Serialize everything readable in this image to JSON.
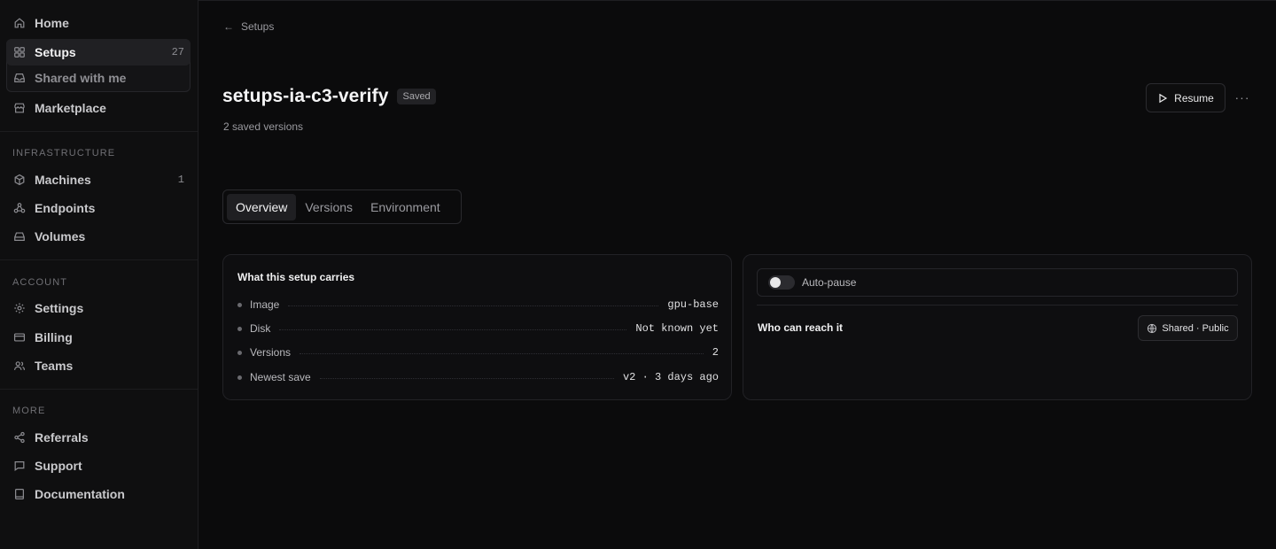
{
  "sidebar": {
    "nav": [
      {
        "label": "Home",
        "icon": "home-icon"
      },
      {
        "label": "Setups",
        "icon": "grid-icon",
        "count": "27"
      },
      {
        "label": "Shared with me",
        "icon": "inbox-icon"
      },
      {
        "label": "Marketplace",
        "icon": "store-icon"
      }
    ],
    "sections": [
      {
        "label": "INFRASTRUCTURE",
        "items": [
          {
            "label": "Machines",
            "icon": "cube-icon",
            "count": "1"
          },
          {
            "label": "Endpoints",
            "icon": "webhook-icon"
          },
          {
            "label": "Volumes",
            "icon": "drive-icon"
          }
        ]
      },
      {
        "label": "ACCOUNT",
        "items": [
          {
            "label": "Settings",
            "icon": "gear-icon"
          },
          {
            "label": "Billing",
            "icon": "card-icon"
          },
          {
            "label": "Teams",
            "icon": "users-icon"
          }
        ]
      },
      {
        "label": "MORE",
        "items": [
          {
            "label": "Referrals",
            "icon": "share-icon"
          },
          {
            "label": "Support",
            "icon": "chat-icon"
          },
          {
            "label": "Documentation",
            "icon": "book-icon"
          }
        ]
      }
    ]
  },
  "breadcrumb": {
    "label": "Setups"
  },
  "header": {
    "title": "setups-ia-c3-verify",
    "badge": "Saved",
    "subtitle": "2 saved versions",
    "resume_label": "Resume",
    "more_label": "···"
  },
  "tabs": [
    {
      "label": "Overview",
      "active": true
    },
    {
      "label": "Versions",
      "active": false
    },
    {
      "label": "Environment",
      "active": false
    }
  ],
  "carries": {
    "title": "What this setup carries",
    "rows": [
      {
        "key": "Image",
        "value": "gpu-base"
      },
      {
        "key": "Disk",
        "value": "Not known yet"
      },
      {
        "key": "Versions",
        "value": "2"
      },
      {
        "key": "Newest save",
        "value": "v2 · 3 days ago"
      }
    ]
  },
  "access": {
    "auto_pause_label": "Auto-pause",
    "auto_pause_on": false,
    "reach_label": "Who can reach it",
    "share_label": "Shared · Public"
  }
}
